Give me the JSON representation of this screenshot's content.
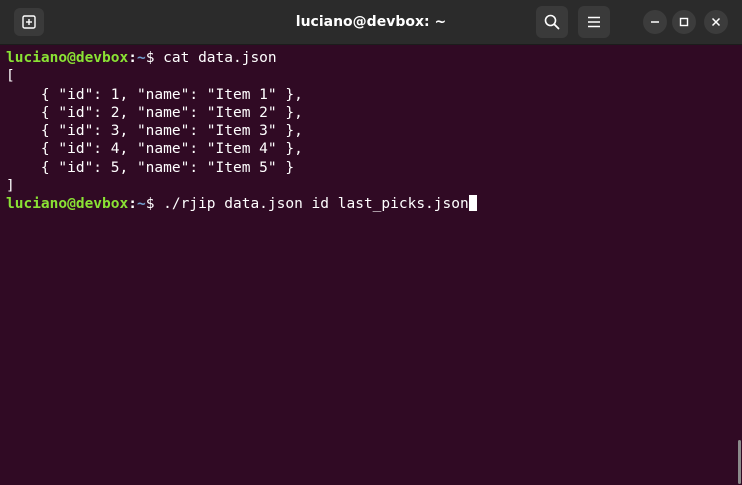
{
  "window": {
    "title": "luciano@devbox: ~",
    "background": "#300a24"
  },
  "icons": {
    "new_tab": "new-tab-icon",
    "search": "search-icon",
    "menu": "hamburger-menu-icon",
    "minimize": "minimize-icon",
    "maximize": "maximize-icon",
    "close": "close-icon"
  },
  "prompt": {
    "user_host": "luciano@devbox",
    "colon": ":",
    "path": "~",
    "dollar": "$ "
  },
  "terminal": {
    "command_1": "cat data.json",
    "output": [
      "[",
      "    { \"id\": 1, \"name\": \"Item 1\" },",
      "    { \"id\": 2, \"name\": \"Item 2\" },",
      "    { \"id\": 3, \"name\": \"Item 3\" },",
      "    { \"id\": 4, \"name\": \"Item 4\" },",
      "    { \"id\": 5, \"name\": \"Item 5\" }",
      "]"
    ],
    "command_2": "./rjip data.json id last_picks.json"
  },
  "colors": {
    "prompt_user": "#8ae234",
    "prompt_path": "#729fcf",
    "text": "#ffffff",
    "titlebar": "#2b2b2b"
  }
}
